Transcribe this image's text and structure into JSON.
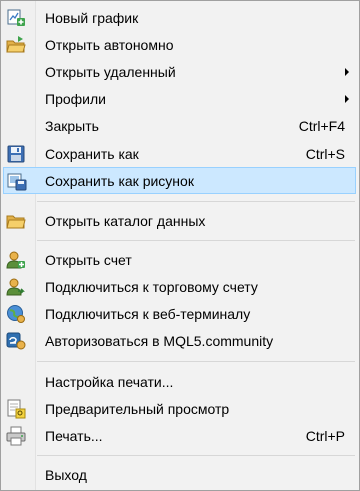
{
  "menu": {
    "items": [
      {
        "label": "Новый график",
        "icon": "new-chart-icon",
        "shortcut": "",
        "submenu": false,
        "selected": false
      },
      {
        "label": "Открыть автономно",
        "icon": "open-folder-icon",
        "shortcut": "",
        "submenu": false,
        "selected": false
      },
      {
        "label": "Открыть удаленный",
        "icon": "",
        "shortcut": "",
        "submenu": true,
        "selected": false
      },
      {
        "label": "Профили",
        "icon": "",
        "shortcut": "",
        "submenu": true,
        "selected": false
      },
      {
        "label": "Закрыть",
        "icon": "",
        "shortcut": "Ctrl+F4",
        "submenu": false,
        "selected": false
      },
      {
        "label": "Сохранить как",
        "icon": "save-disk-icon",
        "shortcut": "Ctrl+S",
        "submenu": false,
        "selected": false
      },
      {
        "label": "Сохранить как рисунок",
        "icon": "save-picture-icon",
        "shortcut": "",
        "submenu": false,
        "selected": true
      },
      {
        "label": "Открыть каталог данных",
        "icon": "data-folder-icon",
        "shortcut": "",
        "submenu": false,
        "selected": false
      },
      {
        "label": "Открыть счет",
        "icon": "open-account-icon",
        "shortcut": "",
        "submenu": false,
        "selected": false
      },
      {
        "label": "Подключиться к торговому счету",
        "icon": "connect-account-icon",
        "shortcut": "",
        "submenu": false,
        "selected": false
      },
      {
        "label": "Подключиться к веб-терминалу",
        "icon": "web-terminal-globe-icon",
        "shortcut": "",
        "submenu": false,
        "selected": false
      },
      {
        "label": "Авторизоваться в MQL5.community",
        "icon": "mql5-community-icon",
        "shortcut": "",
        "submenu": false,
        "selected": false
      },
      {
        "label": "Настройка печати...",
        "icon": "",
        "shortcut": "",
        "submenu": false,
        "selected": false
      },
      {
        "label": "Предварительный просмотр",
        "icon": "print-preview-icon",
        "shortcut": "",
        "submenu": false,
        "selected": false
      },
      {
        "label": "Печать...",
        "icon": "printer-icon",
        "shortcut": "Ctrl+P",
        "submenu": false,
        "selected": false
      },
      {
        "label": "Выход",
        "icon": "",
        "shortcut": "",
        "submenu": false,
        "selected": false
      }
    ]
  },
  "colors": {
    "selection_bg": "#cce8ff",
    "selection_border": "#99d1ff",
    "menu_bg": "#f2f2f2"
  }
}
